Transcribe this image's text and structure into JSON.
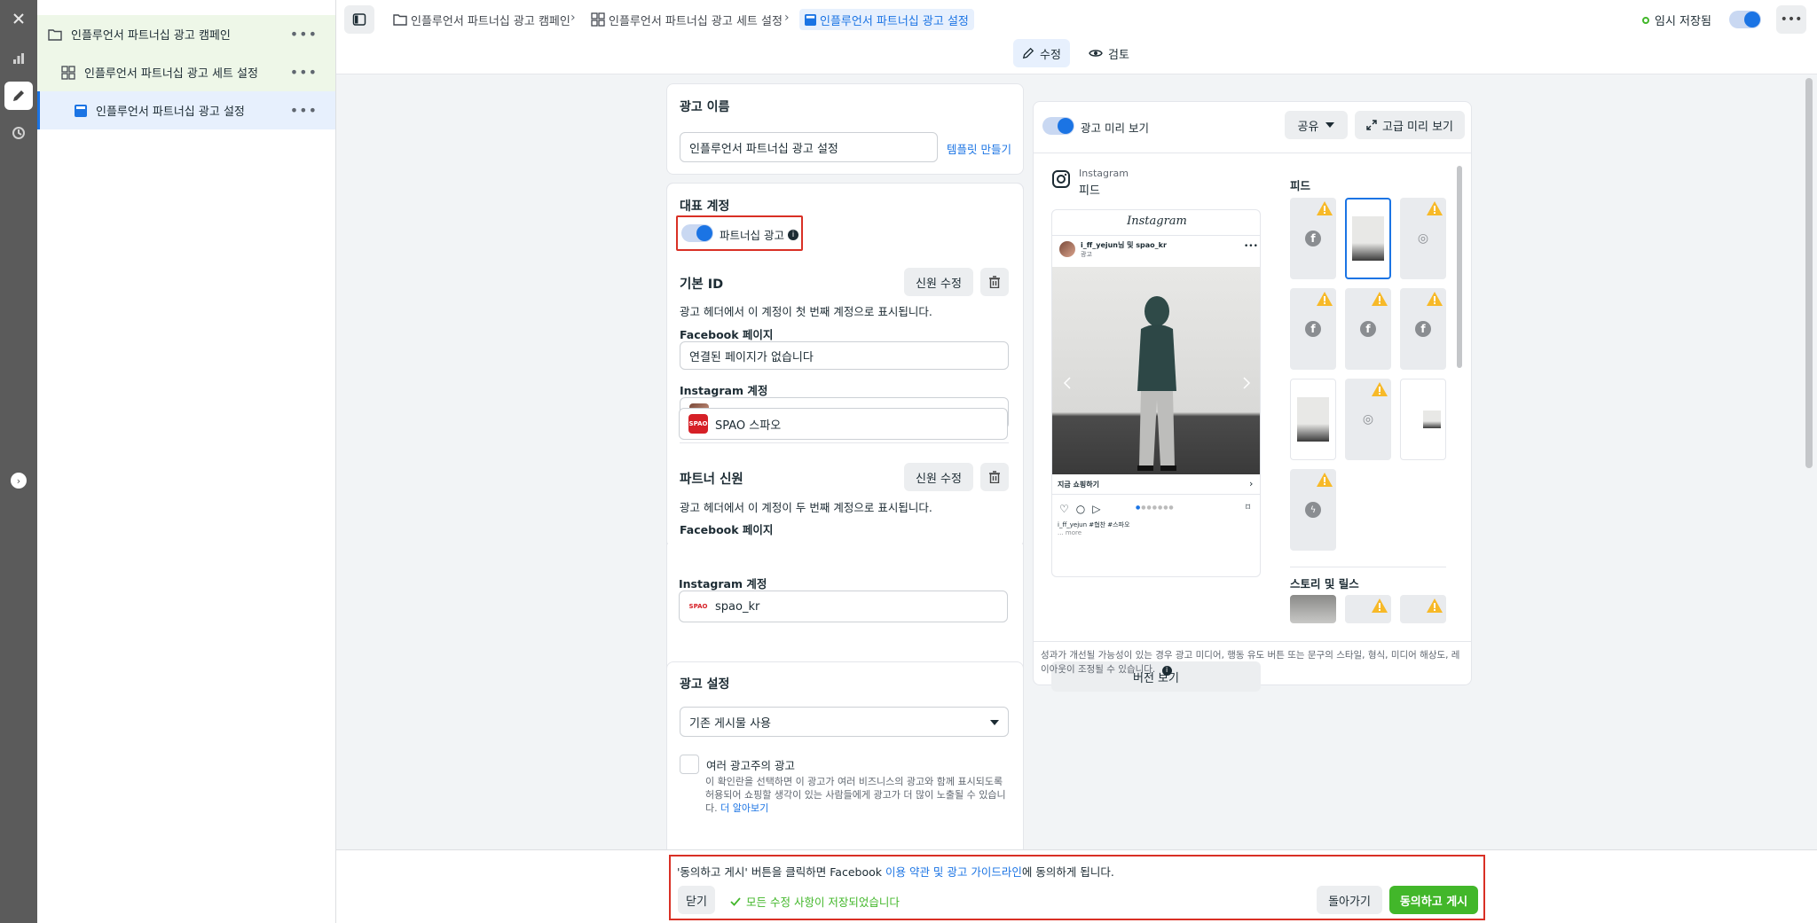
{
  "tree": {
    "campaign": "인플루언서 파트너십 광고 캠페인",
    "adset": "인플루언서 파트너십 광고 세트 설정",
    "ad": "인플루언서 파트너십 광고 설정"
  },
  "breadcrumb": {
    "campaign": "인플루언서 파트너십 광고 캠페인",
    "adset": "인플루언서 파트너십 광고 세트 설정",
    "ad": "인플루언서 파트너십 광고 설정"
  },
  "header": {
    "status": "임시 저장됨",
    "tab_edit": "수정",
    "tab_review": "검토"
  },
  "ad_name": {
    "title": "광고 이름",
    "value": "인플루언서  파트너십 광고 설정",
    "template_link": "템플릿 만들기"
  },
  "identity": {
    "title": "대표 계정",
    "partnership_label": "파트너십 광고",
    "primary": {
      "title": "기본 ID",
      "edit_button": "신원 수정",
      "desc": "광고 헤더에서 이 계정이 첫 번째 계정으로 표시됩니다.",
      "fb_label": "Facebook 페이지",
      "fb_value": "연결된 페이지가 없습니다",
      "ig_label": "Instagram 계정",
      "ig_value": "i_ff_yejun"
    },
    "partner": {
      "title": "파트너 신원",
      "edit_button": "신원 수정",
      "desc": "광고 헤더에서 이 계정이 두 번째 계정으로 표시됩니다.",
      "fb_label": "Facebook 페이지",
      "fb_value": "SPAO 스파오",
      "ig_label": "Instagram 계정",
      "ig_value": "spao_kr",
      "logo_text": "SPAO"
    }
  },
  "ad_setup": {
    "title": "광고 설정",
    "select_value": "기존 게시물 사용",
    "multi_title": "여러 광고주의 광고",
    "multi_desc": "이 확인란을 선택하면 이 광고가 여러 비즈니스의 광고와 함께 표시되도록 허용되어 쇼핑할 생각이 있는 사람들에게 광고가 더 많이 노출될 수 있습니다.",
    "learn_more": "더 알아보기"
  },
  "preview": {
    "toggle_label": "광고 미리 보기",
    "share_button": "공유",
    "advanced_button": "고급 미리 보기",
    "platform": "Instagram",
    "placement": "피드",
    "ig_logo": "Instagram",
    "post_author": "i_ff_yejun님 및 spao_kr",
    "post_sub": "광고",
    "cta": "지금 쇼핑하기",
    "caption": "i_ff_yejun #협찬 #스파오",
    "more": "... more",
    "version_button": "버전 보기",
    "feed_header": "피드",
    "stories_header": "스토리 및 릴스",
    "note": "성과가 개선될 가능성이 있는 경우 광고 미디어, 행동 유도 버튼 또는 문구의 스타일, 형식, 미디어 해상도, 레이아웃이 조정될 수 있습니다."
  },
  "footer": {
    "notice_pre": "'동의하고 게시' 버튼을 클릭하면 Facebook ",
    "notice_link": "이용 약관 및 광고 가이드라인",
    "notice_post": "에 동의하게 됩니다.",
    "close_button": "닫기",
    "saved_text": "모든 수정 사항이 저장되었습니다",
    "back_button": "돌아가기",
    "publish_button": "동의하고 게시"
  },
  "colors": {
    "accent": "#1b74e4",
    "publish": "#42b72a",
    "highlight_box": "#d93025",
    "warning": "#f7b928"
  }
}
